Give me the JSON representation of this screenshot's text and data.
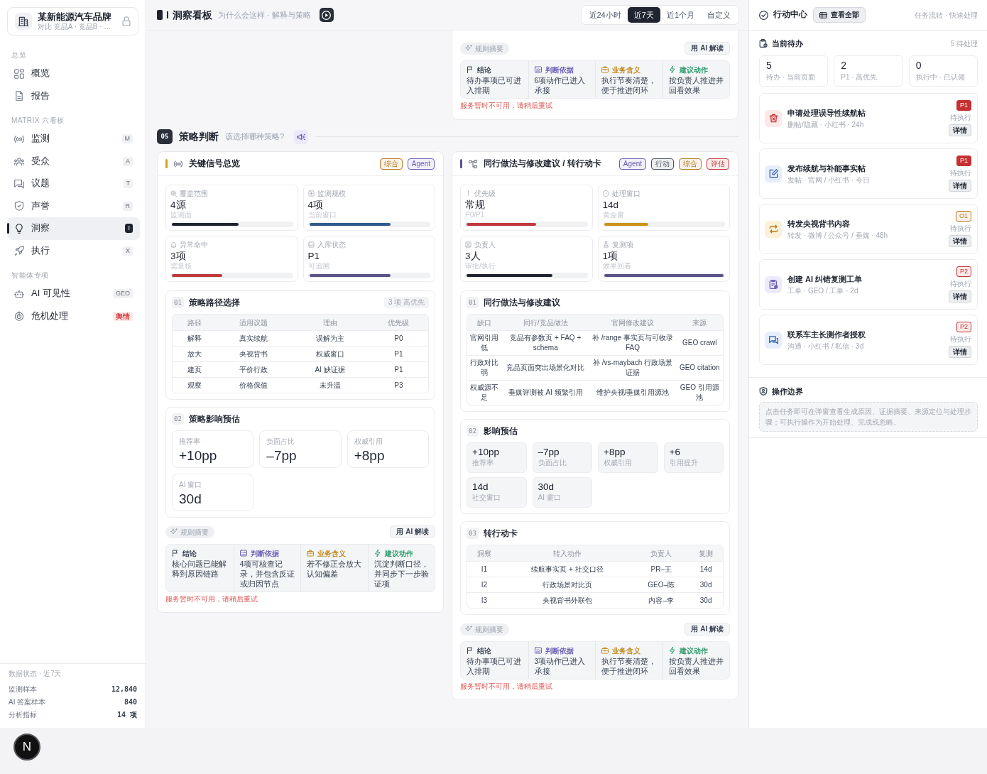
{
  "sidebar": {
    "brand": {
      "name": "某新能源汽车品牌",
      "subtitle": "对比 竞品A · 竞品B · …"
    },
    "groups": [
      {
        "label": "总览",
        "items": [
          {
            "kind": "overview",
            "label": "概览",
            "selected": false
          },
          {
            "kind": "report",
            "label": "报告",
            "selected": false
          }
        ]
      },
      {
        "label": "MATRIX 六看板",
        "items": [
          {
            "kind": "monitor",
            "label": "监测",
            "badge": {
              "text": "M",
              "kind": "key"
            },
            "selected": false
          },
          {
            "kind": "audience",
            "label": "受众",
            "badge": {
              "text": "A",
              "kind": "key"
            },
            "selected": false
          },
          {
            "kind": "topic",
            "label": "议题",
            "badge": {
              "text": "T",
              "kind": "key"
            },
            "selected": false
          },
          {
            "kind": "reputation",
            "label": "声誉",
            "badge": {
              "text": "R",
              "kind": "key"
            },
            "selected": false
          },
          {
            "kind": "insight",
            "label": "洞察",
            "badge": {
              "text": "I",
              "kind": "key"
            },
            "selected": true
          },
          {
            "kind": "execute",
            "label": "执行",
            "badge": {
              "text": "X",
              "kind": "key"
            },
            "selected": false
          }
        ]
      },
      {
        "label": "智能体专项",
        "items": [
          {
            "kind": "visibility",
            "label": "AI 可见性",
            "badge": {
              "text": "GEO",
              "kind": "key"
            },
            "selected": false
          },
          {
            "kind": "crisis",
            "label": "危机处理",
            "badge": {
              "text": "舆情",
              "kind": "alert"
            },
            "selected": false
          }
        ]
      }
    ],
    "data_status": {
      "title": "数据状态 · 近7天",
      "rows": [
        {
          "label": "监测样本",
          "value": "12,840"
        },
        {
          "label": "AI 答案样本",
          "value": "840"
        },
        {
          "label": "分析指标",
          "value": "14 项"
        }
      ]
    }
  },
  "header": {
    "key": "I",
    "title": "洞察看板",
    "subtitle": "为什么会这样 · 解释与策略",
    "ranges": [
      {
        "label": "近24小时",
        "selected": false
      },
      {
        "label": "近7天",
        "selected": true
      },
      {
        "label": "近1个月",
        "selected": false
      },
      {
        "label": "自定义",
        "selected": false
      }
    ]
  },
  "main": {
    "top_card": {
      "rules_label": "规则摘要",
      "ai_button": "用 AI 解读",
      "summary": [
        {
          "kind": "conclusion",
          "title": "结论",
          "text": "待办事项已可进入排期"
        },
        {
          "kind": "basis",
          "title": "判断依据",
          "text": "6项动作已进入承接"
        },
        {
          "kind": "meaning",
          "title": "业务含义",
          "text": "执行节奏清楚，便于推进闭环"
        },
        {
          "kind": "action",
          "title": "建议动作",
          "text": "按负责人推进并回看效果"
        }
      ],
      "error": "服务暂时不可用，请稍后重试"
    },
    "section": {
      "number": "05",
      "title": "策略判断",
      "question": "该选择哪种策略?"
    },
    "cards": [
      {
        "kind": "signal",
        "title": "关键信号总览",
        "color": "#d4a017",
        "tags": [
          {
            "label": "综合",
            "color": "#b7791f"
          },
          {
            "label": "Agent",
            "color": "#6b5fb5"
          }
        ],
        "metrics": [
          {
            "kind": "coverage",
            "label": "覆盖范围",
            "value": "4源",
            "sub": "监测面",
            "level": 0.56,
            "color": "#1f2430"
          },
          {
            "kind": "scale",
            "label": "监测规模",
            "value": "4项",
            "sub": "当前窗口",
            "level": 0.68,
            "color": "#2f5b8a"
          },
          {
            "kind": "anomaly",
            "label": "异常命中",
            "value": "3项",
            "sub": "需复核",
            "level": 0.42,
            "color": "#c0393b"
          },
          {
            "kind": "storage",
            "label": "入库状态",
            "value": "P1",
            "sub": "可追溯",
            "level": 0.68,
            "color": "#5b5488"
          }
        ],
        "blocks": [
          {
            "kind": "table",
            "number": "01",
            "title": "策略路径选择",
            "tag": "3 项 高优先",
            "columns": [
              "路径",
              "适用议题",
              "理由",
              "优先级"
            ],
            "rows": [
              [
                "解释",
                "真实续航",
                "误解为主",
                "P0"
              ],
              [
                "放大",
                "央视背书",
                "权威窗口",
                "P1"
              ],
              [
                "建页",
                "平价行政",
                "AI 缺证据",
                "P1"
              ],
              [
                "观察",
                "价格保值",
                "未升温",
                "P3"
              ]
            ]
          },
          {
            "kind": "stats",
            "number": "02",
            "title": "策略影响预估",
            "items": [
              {
                "label": "推荐率",
                "value": "+10pp"
              },
              {
                "label": "负面占比",
                "value": "–7pp"
              },
              {
                "label": "权威引用",
                "value": "+8pp"
              },
              {
                "label": "AI 窗口",
                "value": "30d"
              }
            ]
          }
        ],
        "rules_label": "规则摘要",
        "ai_button": "用 AI 解读",
        "summary": [
          {
            "kind": "conclusion",
            "title": "结论",
            "text": "核心问题已能解释到原因链路"
          },
          {
            "kind": "basis",
            "title": "判断依据",
            "text": "4项可核查记录，并包含反证或归因节点"
          },
          {
            "kind": "meaning",
            "title": "业务含义",
            "text": "若不修正会放大认知偏差"
          },
          {
            "kind": "action",
            "title": "建议动作",
            "text": "沉淀判断口径，并同步下一步验证项"
          }
        ],
        "error": "服务暂时不可用，请稍后重试"
      },
      {
        "kind": "flow",
        "title": "同行做法与修改建议 / 转行动卡",
        "color": "#5b5488",
        "tags": [
          {
            "label": "Agent",
            "color": "#6b5fb5"
          },
          {
            "label": "行动",
            "color": "#4b5563"
          },
          {
            "label": "综合",
            "color": "#b7791f"
          },
          {
            "label": "评估",
            "color": "#c0393b"
          }
        ],
        "metrics": [
          {
            "kind": "priority",
            "label": "优先级",
            "value": "常规",
            "sub": "P0/P1",
            "level": 0.58,
            "color": "#c0393b"
          },
          {
            "kind": "window",
            "label": "处理窗口",
            "value": "14d",
            "sub": "黄金窗",
            "level": 0.37,
            "color": "#c8941a"
          },
          {
            "kind": "owner",
            "label": "负责人",
            "value": "3人",
            "sub": "审批/执行",
            "level": 0.72,
            "color": "#1f2430"
          },
          {
            "kind": "retest",
            "label": "复测项",
            "value": "1项",
            "sub": "效果回看",
            "level": 1,
            "color": "#5b5488"
          }
        ],
        "blocks": [
          {
            "kind": "table",
            "number": "01",
            "title": "同行做法与修改建议",
            "columns": [
              "缺口",
              "同行/竞品做法",
              "官网修改建议",
              "来源"
            ],
            "rows": [
              [
                "官网引用低",
                "竞品有参数页 + FAQ + schema",
                "补 /range 事实页与可收录 FAQ",
                "GEO crawl"
              ],
              [
                "行政对比弱",
                "竞品页面突出场景化对比",
                "补 /vs-maybach 行政场景证据",
                "GEO citation"
              ],
              [
                "权威源不足",
                "垂媒评测被 AI 频繁引用",
                "维护央视/垂媒引用源池",
                "GEO 引用源池"
              ]
            ]
          },
          {
            "kind": "tiles",
            "number": "02",
            "title": "影响预估",
            "items": [
              {
                "value": "+10pp",
                "label": "推荐率"
              },
              {
                "value": "–7pp",
                "label": "负面占比"
              },
              {
                "value": "+8pp",
                "label": "权威引用"
              },
              {
                "value": "+6",
                "label": "引用提升"
              },
              {
                "value": "14d",
                "label": "社交窗口"
              },
              {
                "value": "30d",
                "label": "AI 窗口"
              }
            ]
          },
          {
            "kind": "table",
            "number": "03",
            "title": "转行动卡",
            "columns": [
              "洞察",
              "转入动作",
              "负责人",
              "复测"
            ],
            "rows": [
              [
                "I1",
                "续航事实页 + 社交口径",
                "PR–王",
                "14d"
              ],
              [
                "I2",
                "行政场景对比页",
                "GEO–陈",
                "30d"
              ],
              [
                "I3",
                "央视背书外联包",
                "内容–李",
                "30d"
              ]
            ]
          }
        ],
        "rules_label": "规则摘要",
        "ai_button": "用 AI 解读",
        "summary": [
          {
            "kind": "conclusion",
            "title": "结论",
            "text": "待办事项已可进入排期"
          },
          {
            "kind": "basis",
            "title": "判断依据",
            "text": "3项动作已进入承接"
          },
          {
            "kind": "meaning",
            "title": "业务含义",
            "text": "执行节奏清楚，便于推进闭环"
          },
          {
            "kind": "action",
            "title": "建议动作",
            "text": "按负责人推进并回看效果"
          }
        ],
        "error": "服务暂时不可用，请稍后重试"
      }
    ]
  },
  "action_center": {
    "title": "行动中心",
    "view_all": "查看全部",
    "caption": "任务流转 · 快速处理",
    "todo": {
      "title": "当前待办",
      "count": "5 待处理",
      "stats": [
        {
          "value": "5",
          "label": "待办 · 当前页面"
        },
        {
          "value": "2",
          "label": "P1 · 高优先"
        },
        {
          "value": "0",
          "label": "执行中 · 已认领"
        }
      ],
      "tasks": [
        {
          "kind": "remove",
          "title": "申请处理误导性续航帖",
          "meta": "删帖/隐藏 · 小红书 · 24h",
          "priority": {
            "label": "P1",
            "kind": "solid",
            "color": "#c53030"
          },
          "status": "待执行",
          "button": "详情"
        },
        {
          "kind": "post",
          "title": "发布续航与补能事实帖",
          "meta": "发帖 · 官网 / 小红书 · 今日",
          "priority": {
            "label": "P1",
            "kind": "solid",
            "color": "#c53030"
          },
          "status": "待执行",
          "button": "详情"
        },
        {
          "kind": "repost",
          "title": "转发央视背书内容",
          "meta": "转发 · 微博 / 公众号 / 垂媒 · 48h",
          "priority": {
            "label": "O1",
            "kind": "soft",
            "color": "#b7791f"
          },
          "status": "待执行",
          "button": "详情"
        },
        {
          "kind": "ticket",
          "title": "创建 AI 纠错复测工单",
          "meta": "工单 · GEO / 工单 · 2d",
          "priority": {
            "label": "P2",
            "kind": "soft",
            "color": "#c53030"
          },
          "status": "待执行",
          "button": "详情"
        },
        {
          "kind": "contact",
          "title": "联系车主长测作者授权",
          "meta": "沟通 · 小红书 / 私信 · 3d",
          "priority": {
            "label": "P2",
            "kind": "soft",
            "color": "#c53030"
          },
          "status": "待执行",
          "button": "详情"
        }
      ]
    },
    "boundary": {
      "title": "操作边界",
      "text": "点击任务即可在弹窗查看生成原因、证据摘要、来源定位与处理步骤；可执行操作为开始处理、完成或忽略。"
    }
  },
  "dev_badge": {
    "label": "N"
  }
}
